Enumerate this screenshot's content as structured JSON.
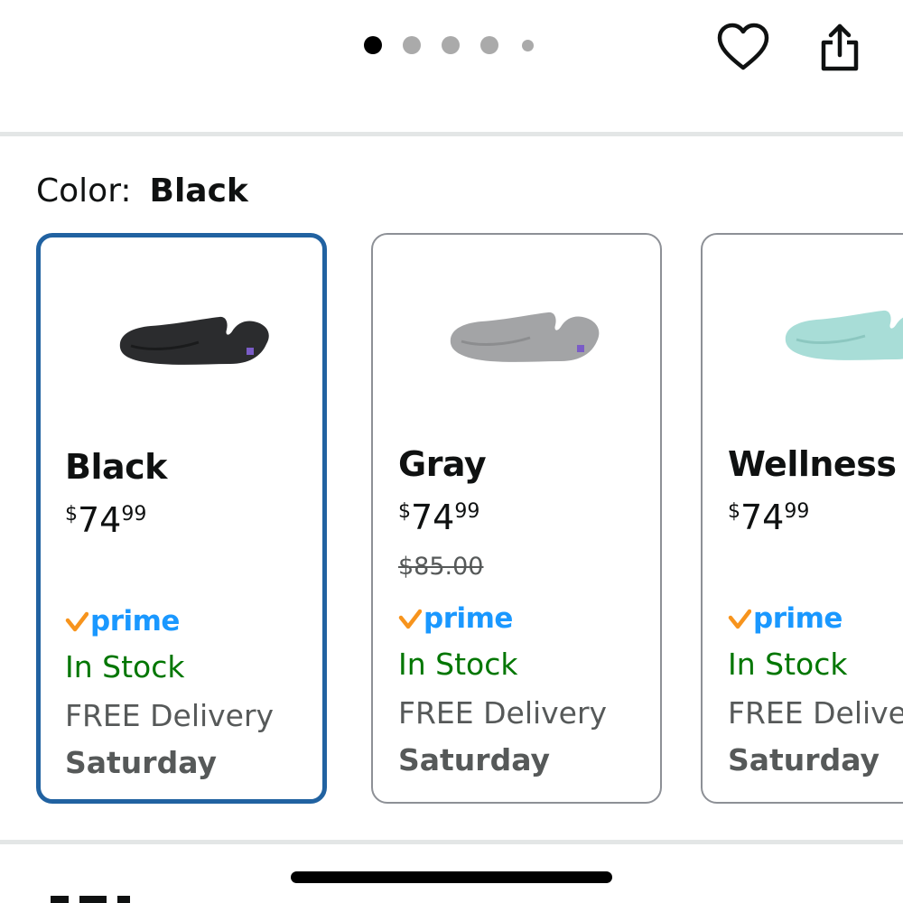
{
  "carousel": {
    "dots": [
      {
        "state": "active"
      },
      {
        "state": "inactive"
      },
      {
        "state": "inactive"
      },
      {
        "state": "inactive"
      },
      {
        "state": "inactive-small"
      }
    ]
  },
  "header_actions": {
    "favorite_icon": "heart-outline-icon",
    "share_icon": "share-icon"
  },
  "color_selector": {
    "label": "Color:",
    "selected": "Black",
    "options": [
      {
        "name": "Black",
        "price_symbol": "$",
        "price_whole": "74",
        "price_fraction": "99",
        "list_price": "",
        "prime": "prime",
        "availability": "In Stock",
        "delivery": "FREE Delivery",
        "delivery_day": "Saturday",
        "product_color": "#2b2c2e",
        "selected": true
      },
      {
        "name": "Gray",
        "price_symbol": "$",
        "price_whole": "74",
        "price_fraction": "99",
        "list_price": "$85.00",
        "prime": "prime",
        "availability": "In Stock",
        "delivery": "FREE Delivery",
        "delivery_day": "Saturday",
        "product_color": "#a3a4a6",
        "selected": false
      },
      {
        "name": "Wellness G",
        "price_symbol": "$",
        "price_whole": "74",
        "price_fraction": "99",
        "list_price": "",
        "prime": "prime",
        "availability": "In Stock",
        "delivery": "FREE Delivery",
        "delivery_day": "Saturday",
        "product_color": "#a8ddd7",
        "selected": false
      }
    ]
  },
  "colors": {
    "selected_border": "#2162a1",
    "unselected_border": "#8d9096",
    "prime_blue": "#1a98ff",
    "prime_check": "#f7941d",
    "in_stock": "#007600",
    "secondary_text": "#565959"
  }
}
